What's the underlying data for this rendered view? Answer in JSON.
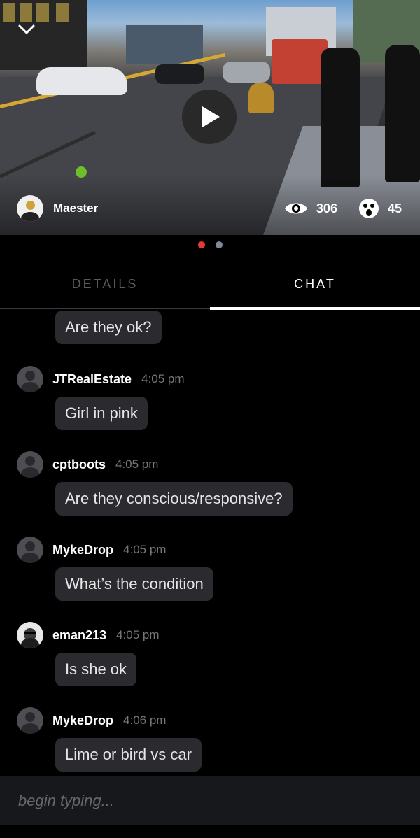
{
  "video": {
    "streamer_name": "Maester",
    "views": "306",
    "reactions": "45"
  },
  "pager": {
    "active_color": "#e53935",
    "inactive_color": "#7f8799"
  },
  "tabs": [
    {
      "label": "DETAILS"
    },
    {
      "label": "CHAT"
    }
  ],
  "chat": {
    "partial_message": "Are they ok?",
    "messages": [
      {
        "user": "JTRealEstate",
        "time": "4:05 pm",
        "text": "Girl in pink"
      },
      {
        "user": "cptboots",
        "time": "4:05 pm",
        "text": "Are they conscious/responsive?"
      },
      {
        "user": "MykeDrop",
        "time": "4:05 pm",
        "text": "What’s the condition"
      },
      {
        "user": "eman213",
        "time": "4:05 pm",
        "text": "Is she ok"
      },
      {
        "user": "MykeDrop",
        "time": "4:06 pm",
        "text": "Lime or bird vs car"
      }
    ]
  },
  "composer": {
    "placeholder": "begin typing..."
  }
}
